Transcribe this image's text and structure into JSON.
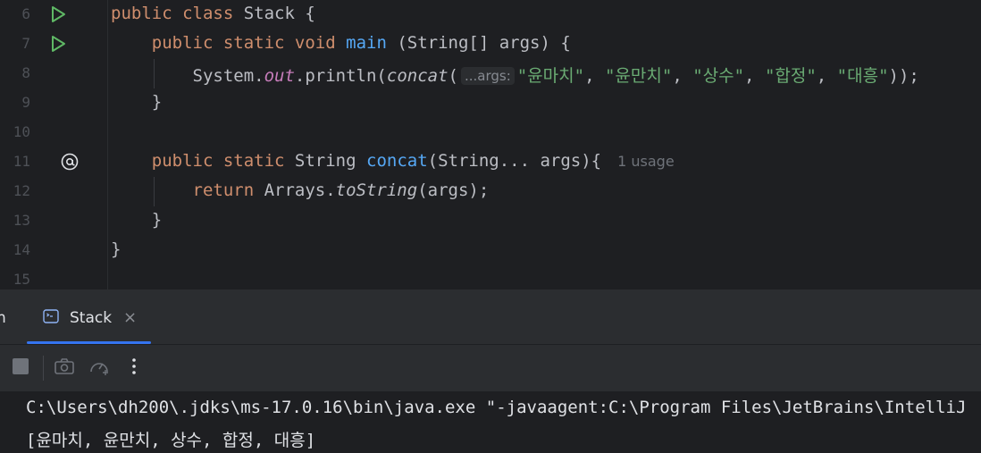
{
  "editor": {
    "line_numbers": [
      "6",
      "7",
      "8",
      "9",
      "10",
      "11",
      "12",
      "13",
      "14",
      "15"
    ],
    "line6": {
      "kw": "public class",
      "rest": " Stack {"
    },
    "line7": {
      "kw": "public static void",
      "fn": "main",
      "rest": " (String[] args) {"
    },
    "line8": {
      "prefix": "System.",
      "field": "out",
      "mid": ".println(",
      "call": "concat",
      "paren": "(",
      "hint": "...args:",
      "strings": [
        "\"윤마치\"",
        "\"윤만치\"",
        "\"상수\"",
        "\"합정\"",
        "\"대흥\""
      ],
      "comma": ", ",
      "suffix": "));"
    },
    "line9": "}",
    "line11": {
      "kw": "public static",
      "type": " String ",
      "fn": "concat",
      "rest": "(String... args){",
      "usage": "1 usage"
    },
    "line12": {
      "kw": "return",
      "pre": " Arrays.",
      "call": "toString",
      "rest": "(args);"
    },
    "line13": "}",
    "line14": "}"
  },
  "panel": {
    "cut_label": "n",
    "tab_label": "Stack",
    "tab_close": "×",
    "console_lines": [
      "C:\\Users\\dh200\\.jdks\\ms-17.0.16\\bin\\java.exe \"-javaagent:C:\\Program Files\\JetBrains\\IntelliJ",
      "[윤마치, 윤만치, 상수, 합정, 대흥]"
    ]
  },
  "colors": {
    "accent": "#3574f0",
    "keyword": "#cf8e6d",
    "function": "#56a8f5",
    "string": "#6aab73",
    "run": "#5fb865"
  }
}
